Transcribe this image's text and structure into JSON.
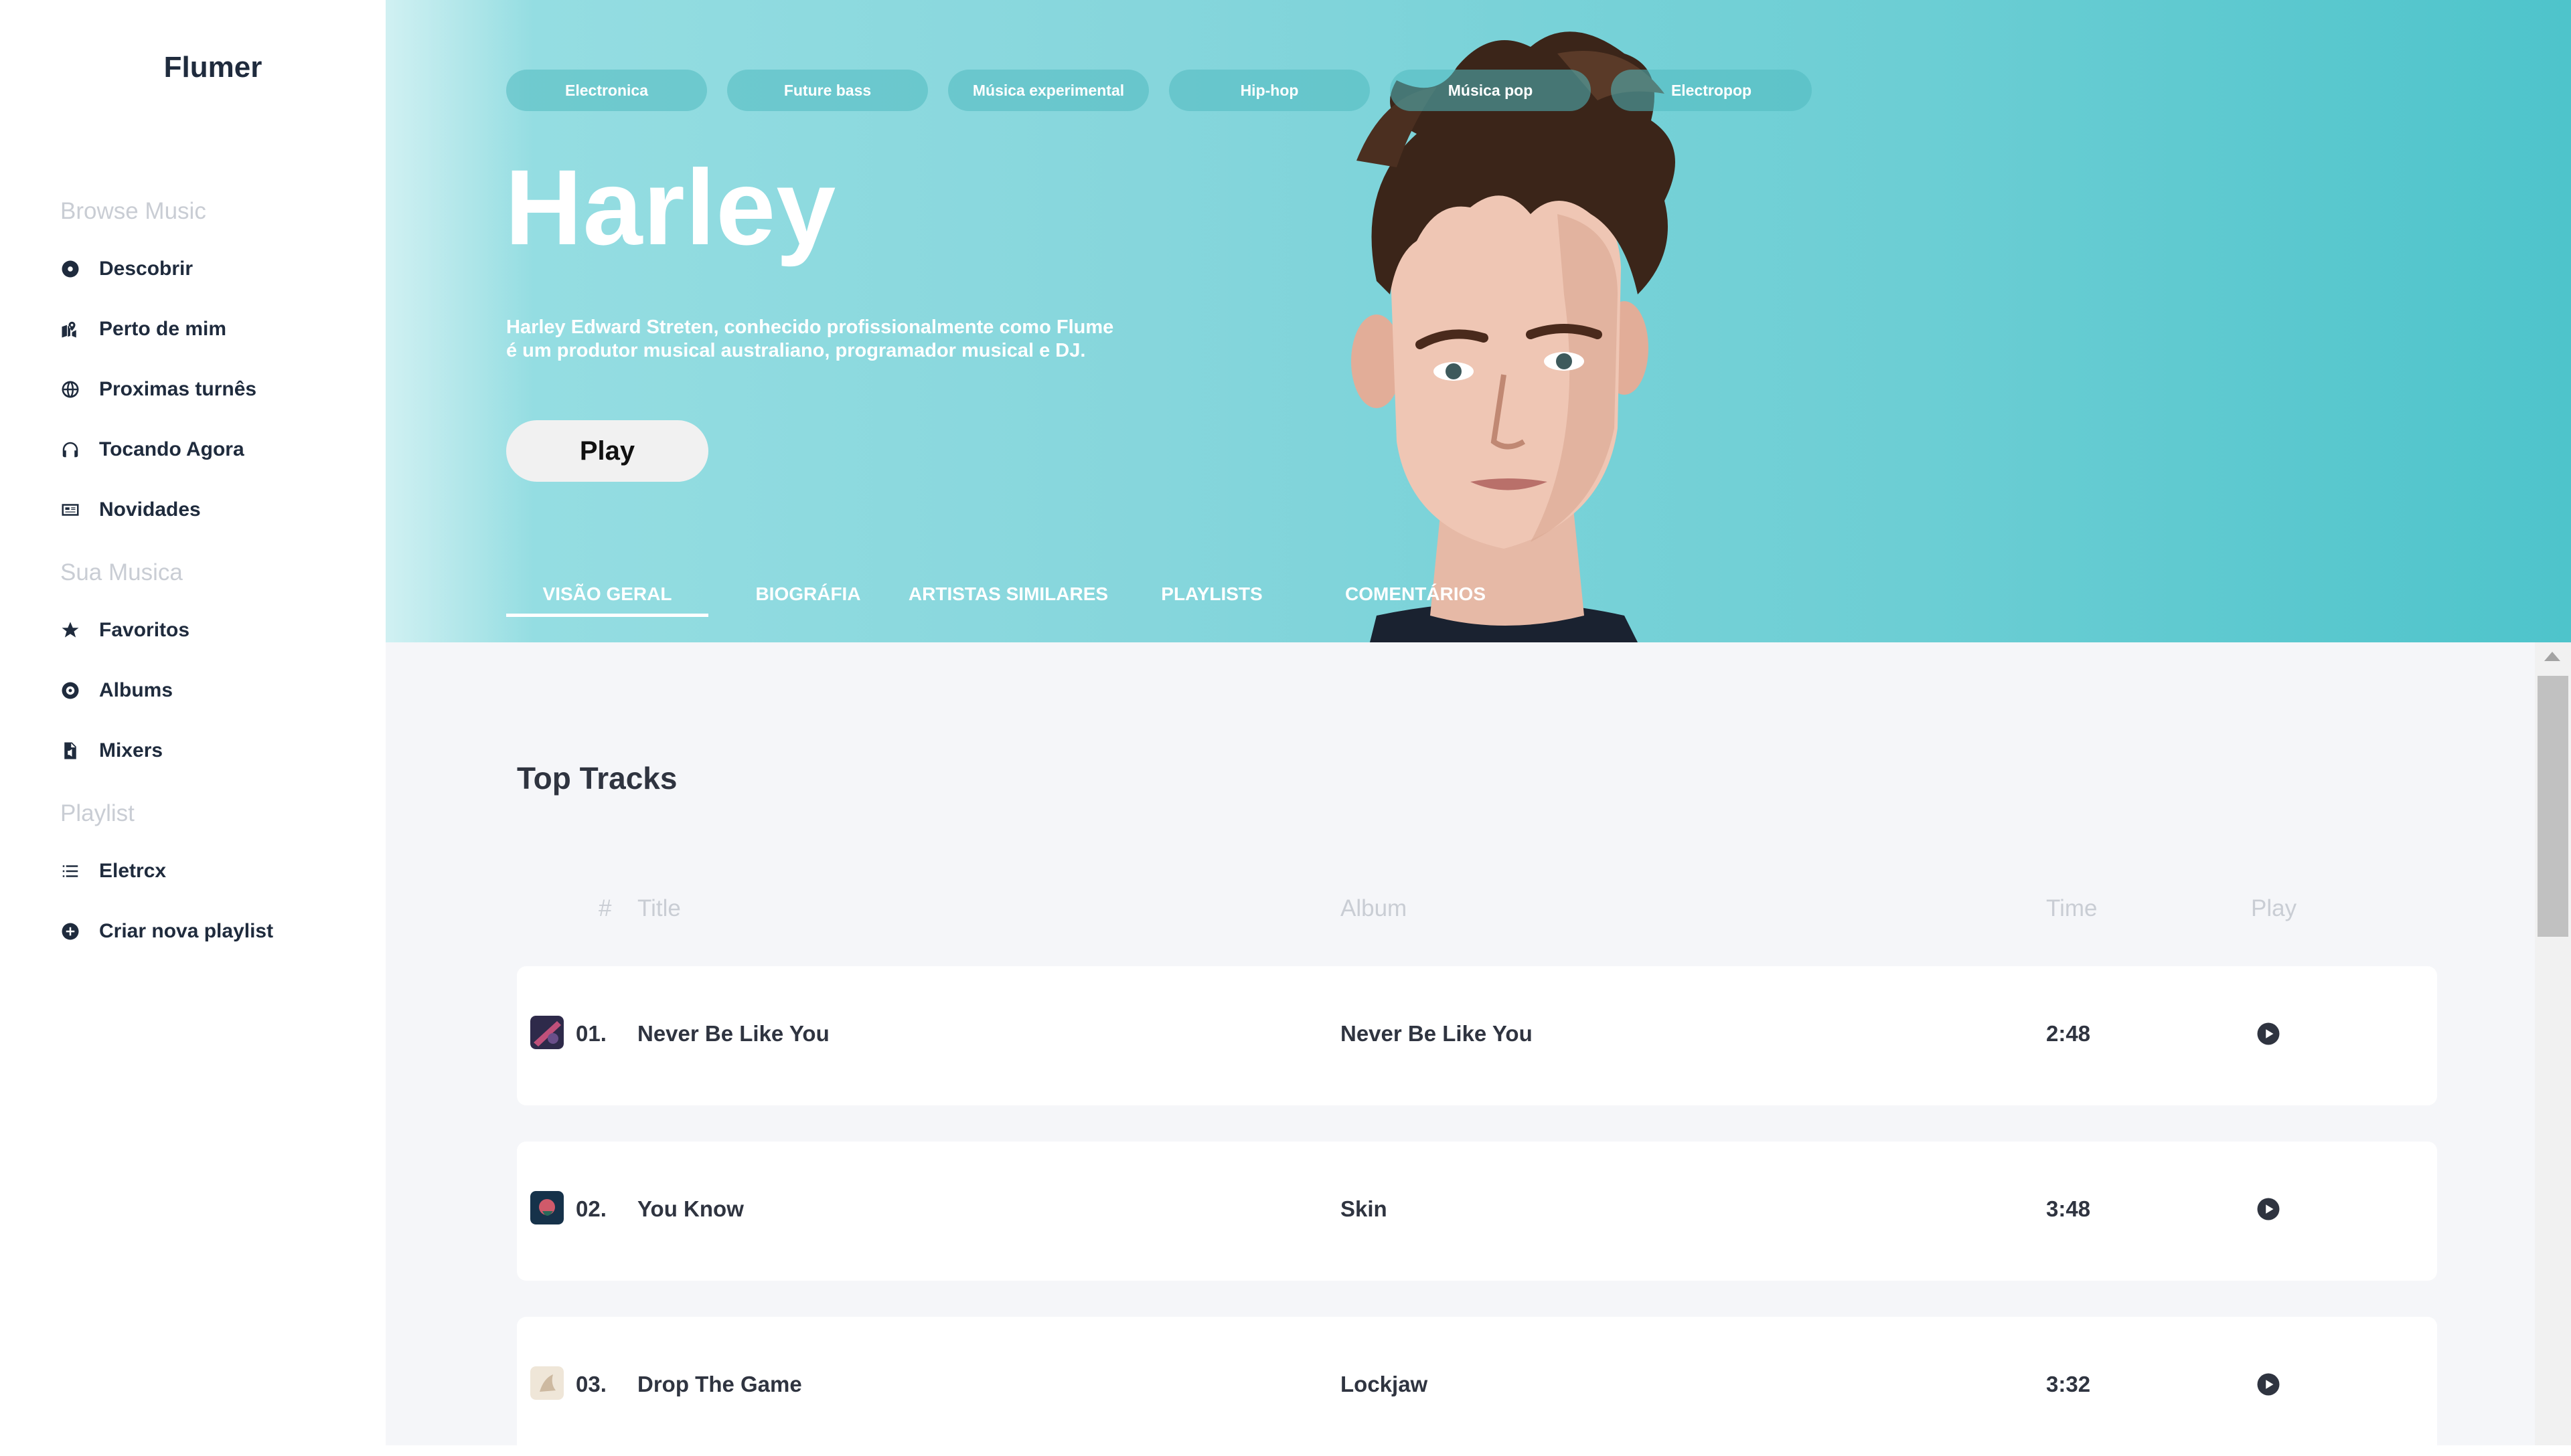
{
  "app": {
    "name": "Flumer"
  },
  "sidebar": {
    "sections": [
      {
        "title": "Browse Music",
        "items": [
          {
            "label": "Descobrir",
            "icon": "disc-icon"
          },
          {
            "label": "Perto de mim",
            "icon": "map-icon"
          },
          {
            "label": "Proximas turnês",
            "icon": "globe-icon"
          },
          {
            "label": "Tocando Agora",
            "icon": "headphones-icon"
          },
          {
            "label": "Novidades",
            "icon": "newspaper-icon"
          }
        ]
      },
      {
        "title": "Sua Musica",
        "items": [
          {
            "label": "Favoritos",
            "icon": "star-icon"
          },
          {
            "label": "Albums",
            "icon": "record-icon"
          },
          {
            "label": "Mixers",
            "icon": "file-audio-icon"
          }
        ]
      },
      {
        "title": "Playlist",
        "items": [
          {
            "label": "Eletrcx",
            "icon": "list-icon"
          },
          {
            "label": "Criar nova playlist",
            "icon": "plus-circle-icon"
          }
        ]
      }
    ]
  },
  "hero": {
    "genres": [
      "Electronica",
      "Future bass",
      "Música experimental",
      "Hip-hop",
      "Música pop",
      "Electropop"
    ],
    "artist_name": "Harley",
    "bio_line1": "Harley Edward Streten, conhecido profissionalmente como Flume",
    "bio_line2": "é um produtor musical australiano, programador musical e DJ.",
    "play_label": "Play",
    "tabs": [
      "VISÃO GERAL",
      "BIOGRÁFIA",
      "ARTISTAS SIMILARES",
      "PLAYLISTS",
      "COMENTÁRIOS"
    ],
    "active_tab": "VISÃO GERAL"
  },
  "top_tracks": {
    "title": "Top Tracks",
    "columns": {
      "number": "#",
      "title": "Title",
      "album": "Album",
      "time": "Time",
      "play": "Play"
    },
    "tracks": [
      {
        "number": "01.",
        "title": "Never Be Like You",
        "album": "Never Be Like You",
        "time": "2:48"
      },
      {
        "number": "02.",
        "title": "You Know",
        "album": "Skin",
        "time": "3:48"
      },
      {
        "number": "03.",
        "title": "Drop The Game",
        "album": "Lockjaw",
        "time": "3:32"
      }
    ]
  },
  "colors": {
    "hero_gradient": [
      "#98dfe3",
      "#4ec4cb"
    ],
    "text_dark": "#1f2b3d",
    "muted": "#c9cdd4",
    "content_bg": "#f5f6f9"
  }
}
